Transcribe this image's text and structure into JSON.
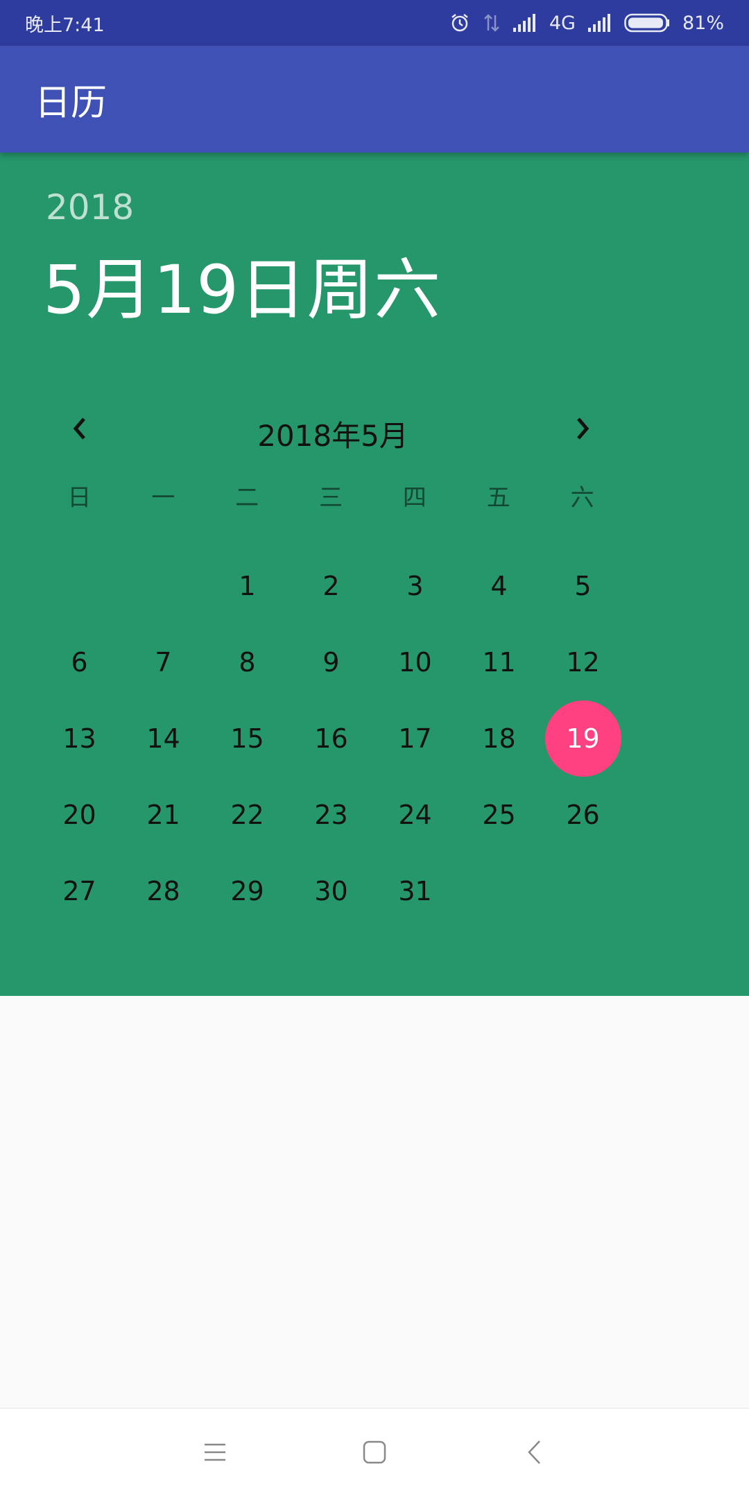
{
  "status_bar": {
    "time": "晚上7:41",
    "network": "4G",
    "battery": "81%",
    "icons": [
      "alarm-icon",
      "data-transfer-icon",
      "signal-icon",
      "signal-icon",
      "battery-icon"
    ]
  },
  "app_bar": {
    "title": "日历"
  },
  "calendar": {
    "year": "2018",
    "selected_date_label": "5月19日周六",
    "month_title": "2018年5月",
    "prev_icon": "chevron-left-icon",
    "next_icon": "chevron-right-icon",
    "weekdays": [
      "日",
      "一",
      "二",
      "三",
      "四",
      "五",
      "六"
    ],
    "days": [
      "",
      "",
      "1",
      "2",
      "3",
      "4",
      "5",
      "6",
      "7",
      "8",
      "9",
      "10",
      "11",
      "12",
      "13",
      "14",
      "15",
      "16",
      "17",
      "18",
      "19",
      "20",
      "21",
      "22",
      "23",
      "24",
      "25",
      "26",
      "27",
      "28",
      "29",
      "30",
      "31",
      "",
      ""
    ],
    "selected_day": "19",
    "colors": {
      "panel": "#26966b",
      "selected": "#ff4081",
      "app_bar": "#3f51b5",
      "status_bar": "#2f3c9f"
    }
  },
  "nav_bar": {
    "buttons": [
      "menu-icon",
      "home-icon",
      "back-icon"
    ]
  }
}
